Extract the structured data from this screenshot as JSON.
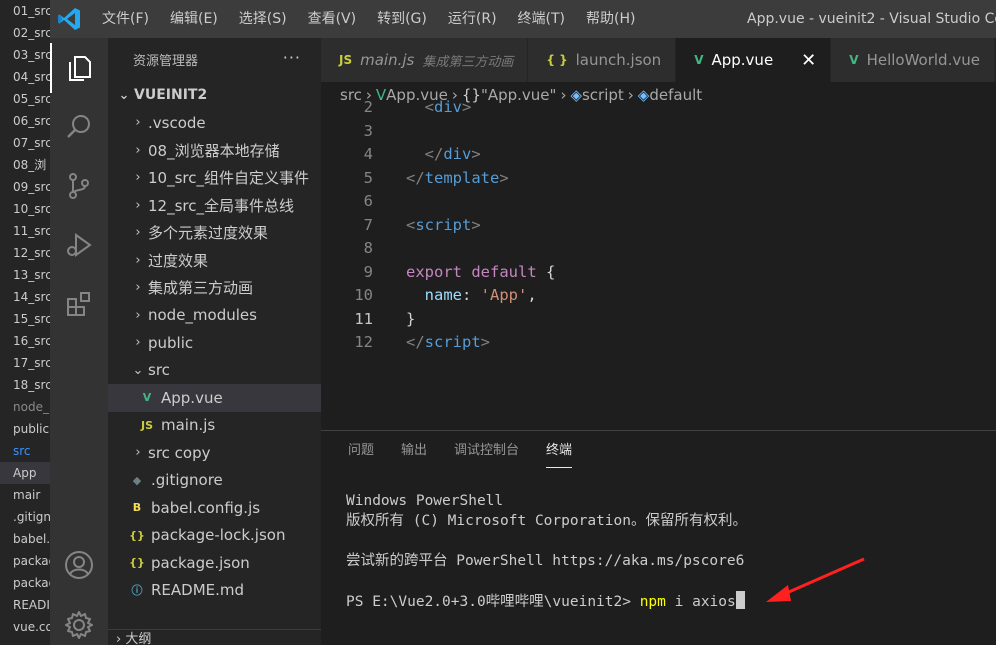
{
  "outer_explorer": {
    "items": [
      {
        "label": "01_src",
        "style": ""
      },
      {
        "label": "02_src",
        "style": ""
      },
      {
        "label": "03_src",
        "style": ""
      },
      {
        "label": "04_src",
        "style": ""
      },
      {
        "label": "05_src",
        "style": ""
      },
      {
        "label": "06_src",
        "style": ""
      },
      {
        "label": "07_src",
        "style": ""
      },
      {
        "label": "08_浏",
        "style": ""
      },
      {
        "label": "09_src",
        "style": ""
      },
      {
        "label": "10_src",
        "style": ""
      },
      {
        "label": "11_src",
        "style": ""
      },
      {
        "label": "12_src",
        "style": ""
      },
      {
        "label": "13_src",
        "style": ""
      },
      {
        "label": "14_src",
        "style": ""
      },
      {
        "label": "15_src",
        "style": ""
      },
      {
        "label": "16_src",
        "style": ""
      },
      {
        "label": "17_src",
        "style": ""
      },
      {
        "label": "18_src",
        "style": ""
      },
      {
        "label": "node_",
        "style": "dim"
      },
      {
        "label": "public",
        "style": ""
      },
      {
        "label": "src",
        "style": "blue"
      },
      {
        "label": "App",
        "style": "sel"
      },
      {
        "label": "mair",
        "style": ""
      },
      {
        "label": ".gitign",
        "style": ""
      },
      {
        "label": "babel.",
        "style": ""
      },
      {
        "label": "packag",
        "style": ""
      },
      {
        "label": "packag",
        "style": ""
      },
      {
        "label": "READI",
        "style": ""
      },
      {
        "label": "vue.co",
        "style": ""
      }
    ]
  },
  "titlebar": {
    "menu": [
      "文件(F)",
      "编辑(E)",
      "选择(S)",
      "查看(V)",
      "转到(G)",
      "运行(R)",
      "终端(T)",
      "帮助(H)"
    ],
    "window_title": "App.vue - vueinit2 - Visual Studio Code"
  },
  "activity_bar": {
    "icons": [
      "explorer-icon",
      "search-icon",
      "source-control-icon",
      "run-debug-icon",
      "extensions-icon",
      "account-icon",
      "settings-gear-icon"
    ]
  },
  "sidebar": {
    "header": "资源管理器",
    "more": "···",
    "section": "VUEINIT2",
    "outline_label": "大纲",
    "items": [
      {
        "label": ".vscode",
        "chevron": "›",
        "icon": "",
        "depth": 0
      },
      {
        "label": "08_浏览器本地存储",
        "chevron": "›",
        "icon": "",
        "depth": 0
      },
      {
        "label": "10_src_组件自定义事件",
        "chevron": "›",
        "icon": "",
        "depth": 0
      },
      {
        "label": "12_src_全局事件总线",
        "chevron": "›",
        "icon": "",
        "depth": 0
      },
      {
        "label": "多个元素过度效果",
        "chevron": "›",
        "icon": "",
        "depth": 0
      },
      {
        "label": "过度效果",
        "chevron": "›",
        "icon": "",
        "depth": 0
      },
      {
        "label": "集成第三方动画",
        "chevron": "›",
        "icon": "",
        "depth": 0
      },
      {
        "label": "node_modules",
        "chevron": "›",
        "icon": "",
        "depth": 0
      },
      {
        "label": "public",
        "chevron": "›",
        "icon": "",
        "depth": 0
      },
      {
        "label": "src",
        "chevron": "⌄",
        "icon": "",
        "depth": 0
      },
      {
        "label": "App.vue",
        "chevron": "",
        "icon": "vue",
        "depth": 1
      },
      {
        "label": "main.js",
        "chevron": "",
        "icon": "js",
        "depth": 1
      },
      {
        "label": "src copy",
        "chevron": "›",
        "icon": "",
        "depth": 0
      },
      {
        "label": ".gitignore",
        "chevron": "",
        "icon": "git",
        "depth": 0
      },
      {
        "label": "babel.config.js",
        "chevron": "",
        "icon": "babel",
        "depth": 0
      },
      {
        "label": "package-lock.json",
        "chevron": "",
        "icon": "json",
        "depth": 0
      },
      {
        "label": "package.json",
        "chevron": "",
        "icon": "json",
        "depth": 0
      },
      {
        "label": "README.md",
        "chevron": "",
        "icon": "info",
        "depth": 0
      }
    ]
  },
  "editor": {
    "tabs": [
      {
        "icon_text": "JS",
        "icon_color": "#cbcb41",
        "label": "main.js",
        "desc": "集成第三方动画",
        "active": false,
        "italic": true
      },
      {
        "icon_text": "{ }",
        "icon_color": "#cbcb41",
        "label": "launch.json",
        "desc": "",
        "active": false,
        "italic": false
      },
      {
        "icon_text": "V",
        "icon_color": "#41b883",
        "label": "App.vue",
        "desc": "",
        "active": true,
        "italic": false
      },
      {
        "icon_text": "V",
        "icon_color": "#41b883",
        "label": "HelloWorld.vue",
        "desc": "",
        "active": false,
        "italic": false
      }
    ],
    "close_glyph": "✕",
    "breadcrumb": [
      "src",
      "App.vue",
      "\"App.vue\"",
      "script",
      "default"
    ],
    "breadcrumb_icons": [
      "",
      "V",
      "{}",
      "◈",
      "◈"
    ],
    "lines": [
      {
        "num": "2",
        "parts": [
          {
            "c": "plain",
            "t": "  "
          },
          {
            "c": "punc",
            "t": "<"
          },
          {
            "c": "tagc",
            "t": "div"
          },
          {
            "c": "punc",
            "t": ">"
          }
        ]
      },
      {
        "num": "3",
        "parts": []
      },
      {
        "num": "4",
        "parts": [
          {
            "c": "plain",
            "t": "  "
          },
          {
            "c": "punc",
            "t": "</"
          },
          {
            "c": "tagc",
            "t": "div"
          },
          {
            "c": "punc",
            "t": ">"
          }
        ]
      },
      {
        "num": "5",
        "parts": [
          {
            "c": "punc",
            "t": "</"
          },
          {
            "c": "tagc",
            "t": "template"
          },
          {
            "c": "punc",
            "t": ">"
          }
        ]
      },
      {
        "num": "6",
        "parts": []
      },
      {
        "num": "7",
        "parts": [
          {
            "c": "punc",
            "t": "<"
          },
          {
            "c": "tagc",
            "t": "script"
          },
          {
            "c": "punc",
            "t": ">"
          }
        ]
      },
      {
        "num": "8",
        "parts": []
      },
      {
        "num": "9",
        "parts": [
          {
            "c": "kw",
            "t": "export"
          },
          {
            "c": "plain",
            "t": " "
          },
          {
            "c": "kw",
            "t": "default"
          },
          {
            "c": "plain",
            "t": " {"
          }
        ]
      },
      {
        "num": "10",
        "parts": [
          {
            "c": "plain",
            "t": "  "
          },
          {
            "c": "prop",
            "t": "name"
          },
          {
            "c": "plain",
            "t": ": "
          },
          {
            "c": "str",
            "t": "'App'"
          },
          {
            "c": "plain",
            "t": ","
          }
        ]
      },
      {
        "num": "11",
        "parts": [
          {
            "c": "plain",
            "t": "}"
          }
        ],
        "current": true
      },
      {
        "num": "12",
        "parts": [
          {
            "c": "punc",
            "t": "</"
          },
          {
            "c": "tagc",
            "t": "script"
          },
          {
            "c": "punc",
            "t": ">"
          }
        ]
      }
    ]
  },
  "panel": {
    "tabs": [
      "问题",
      "输出",
      "调试控制台",
      "终端"
    ],
    "active_tab": "终端",
    "terminal": {
      "lines": [
        "Windows PowerShell",
        "版权所有 (C) Microsoft Corporation。保留所有权利。",
        "",
        "尝试新的跨平台 PowerShell https://aka.ms/pscore6",
        ""
      ],
      "prompt": "PS E:\\Vue2.0+3.0哔哩哔哩\\vueinit2> ",
      "command": "npm",
      "args": " i axios"
    }
  },
  "colors": {
    "annotation_arrow": "#ff2020",
    "vue_green": "#41b883",
    "js_yellow": "#cbcb41",
    "accent_blue": "#3794ff"
  }
}
